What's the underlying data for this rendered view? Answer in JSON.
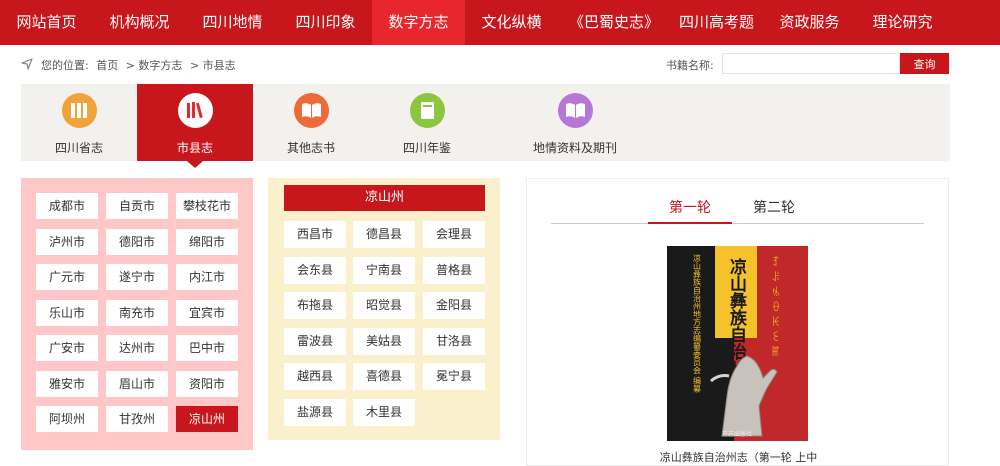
{
  "topnav": {
    "items": [
      {
        "label": "网站首页",
        "active": false
      },
      {
        "label": "机构概况",
        "active": false
      },
      {
        "label": "四川地情",
        "active": false
      },
      {
        "label": "四川印象",
        "active": false
      },
      {
        "label": "数字方志",
        "active": true
      },
      {
        "label": "文化纵横",
        "active": false
      },
      {
        "label": "《巴蜀史志》",
        "active": false
      },
      {
        "label": "四川高考题",
        "active": false
      },
      {
        "label": "资政服务",
        "active": false
      },
      {
        "label": "理论研究",
        "active": false
      }
    ]
  },
  "breadcrumb": {
    "prefix": "您的位置:",
    "home": "首页",
    "level1": "> 数字方志",
    "level2": "> 市县志"
  },
  "search": {
    "label": "书籍名称:",
    "value": "",
    "placeholder": "",
    "button": "查询"
  },
  "category_tabs": [
    {
      "label": "四川省志",
      "active": false,
      "icon": "books-icon",
      "color": "#f0a33a"
    },
    {
      "label": "市县志",
      "active": true,
      "icon": "book-spines-icon",
      "color": "#e8262d"
    },
    {
      "label": "其他志书",
      "active": false,
      "icon": "open-book-icon",
      "color": "#ef6a3a"
    },
    {
      "label": "四川年鉴",
      "active": false,
      "icon": "notebook-icon",
      "color": "#8cc63e"
    },
    {
      "label": "地情资料及期刊",
      "active": false,
      "icon": "open-book-icon",
      "color": "#b678d4"
    }
  ],
  "cities": [
    {
      "label": "成都市",
      "active": false
    },
    {
      "label": "自贡市",
      "active": false
    },
    {
      "label": "攀枝花市",
      "active": false
    },
    {
      "label": "泸州市",
      "active": false
    },
    {
      "label": "德阳市",
      "active": false
    },
    {
      "label": "绵阳市",
      "active": false
    },
    {
      "label": "广元市",
      "active": false
    },
    {
      "label": "遂宁市",
      "active": false
    },
    {
      "label": "内江市",
      "active": false
    },
    {
      "label": "乐山市",
      "active": false
    },
    {
      "label": "南充市",
      "active": false
    },
    {
      "label": "宜宾市",
      "active": false
    },
    {
      "label": "广安市",
      "active": false
    },
    {
      "label": "达州市",
      "active": false
    },
    {
      "label": "巴中市",
      "active": false
    },
    {
      "label": "雅安市",
      "active": false
    },
    {
      "label": "眉山市",
      "active": false
    },
    {
      "label": "资阳市",
      "active": false
    },
    {
      "label": "阿坝州",
      "active": false
    },
    {
      "label": "甘孜州",
      "active": false
    },
    {
      "label": "凉山州",
      "active": true
    }
  ],
  "county_panel": {
    "title": "凉山州",
    "counties": [
      "西昌市",
      "德昌县",
      "会理县",
      "会东县",
      "宁南县",
      "普格县",
      "布拖县",
      "昭觉县",
      "金阳县",
      "雷波县",
      "美姑县",
      "甘洛县",
      "越西县",
      "喜德县",
      "冕宁县",
      "盐源县",
      "木里县"
    ]
  },
  "book_panel": {
    "rounds": [
      {
        "label": "第一轮",
        "active": true
      },
      {
        "label": "第二轮",
        "active": false
      }
    ],
    "cover": {
      "title_main": "凉山彝族自治州志",
      "publisher_vertical": "凉山彝族自治州地方志编纂委员会 编纂",
      "yi_script": "ꆈꌠꁱꂷꀘꏂꂵ",
      "press": "方志出版社",
      "colors": {
        "black": "#1a1a1a",
        "red": "#c0282a",
        "yellow": "#f5c22b"
      }
    },
    "caption": "凉山彝族自治州志（第一轮 上中"
  }
}
